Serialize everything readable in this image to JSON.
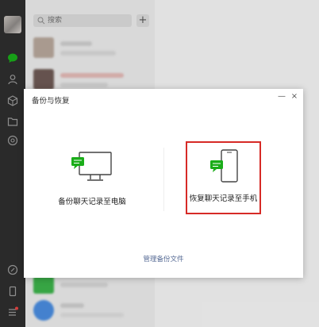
{
  "app": {
    "accent_color": "#1aad19",
    "dark_nav_color": "#2e2e2e"
  },
  "nav": {
    "icons": [
      "avatar",
      "chat-icon",
      "contacts-icon",
      "favorites-icon",
      "folder-icon",
      "moments-icon",
      "mini-program-icon",
      "phone-icon",
      "menu-icon"
    ],
    "menu_badge_color": "#e64340"
  },
  "session_list": {
    "search_placeholder": "搜索",
    "add_label": "+"
  },
  "dialog": {
    "title": "备份与恢复",
    "minimize_label": "—",
    "close_label": "×",
    "option_pc_label": "备份聊天记录至电脑",
    "option_phone_label": "恢复聊天记录至手机",
    "highlight_color": "#d62a26",
    "manage_link": "管理备份文件"
  }
}
